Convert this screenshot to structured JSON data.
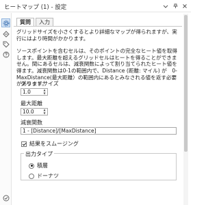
{
  "window": {
    "title": "ヒートマップ (1) - 設定"
  },
  "tabs": [
    {
      "label": "質問"
    },
    {
      "label": "入力"
    }
  ],
  "description": {
    "p1": "グリッドサイズを小さくするとより詳細なマップが得られますが、実行にはより時間がかかります。",
    "p2": "ソースポイントを含むセルは、そのポイントの完全なヒート値を取得します。最大距離を超えるグリッドセルはヒートを得ることができません。間にあるセルは、減衰関数によって割り当てられたヒート値を得ます。減衰関数は0-1の範囲内で、Distance (距離: マイル) が　0-MaxDistance(最大距離）の範囲内にあるとみなされる値を返す必要があります。"
  },
  "fields": {
    "grid_size": {
      "label": "グリッドサイズ",
      "value": "1.0"
    },
    "max_distance": {
      "label": "最大距離",
      "value": "10.0"
    },
    "decay": {
      "label": "減衰関数",
      "value": "1 - [Distance]/[MaxDistance]"
    }
  },
  "smooth": {
    "label": "結果をスムージング",
    "checked": true
  },
  "output": {
    "title": "出力タイプ",
    "options": [
      {
        "label": "積層",
        "selected": true
      },
      {
        "label": "ドーナツ",
        "selected": false
      }
    ]
  },
  "icons": [
    "gear-icon",
    "input-icon",
    "tag-icon",
    "question-icon",
    "check-circle-icon",
    "pin-icon",
    "dropdown-icon",
    "close-icon"
  ]
}
